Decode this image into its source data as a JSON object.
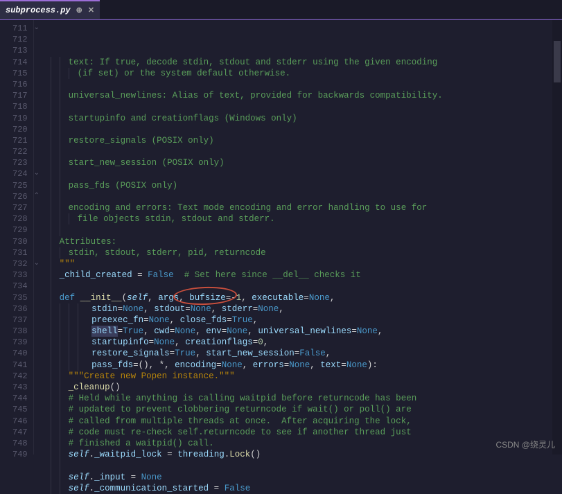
{
  "tab": {
    "filename": "subprocess.py"
  },
  "watermark": "CSDN @绕灵儿",
  "annotation": {
    "text": "shell=True",
    "style": "red-ellipse"
  },
  "lines": [
    {
      "n": 711,
      "fold": "v",
      "ind": 2,
      "seg": [
        [
          "c-comment",
          "text: If true, decode stdin, stdout and stderr using the given encoding"
        ]
      ]
    },
    {
      "n": 712,
      "ind": 3,
      "seg": [
        [
          "c-comment",
          "(if set) or the system default otherwise."
        ]
      ]
    },
    {
      "n": 713,
      "ind": 2,
      "seg": []
    },
    {
      "n": 714,
      "ind": 2,
      "seg": [
        [
          "c-comment",
          "universal_newlines: Alias of text, provided for backwards compatibility."
        ]
      ]
    },
    {
      "n": 715,
      "ind": 2,
      "seg": []
    },
    {
      "n": 716,
      "ind": 2,
      "seg": [
        [
          "c-comment",
          "startupinfo and creationflags (Windows only)"
        ]
      ]
    },
    {
      "n": 717,
      "ind": 2,
      "seg": []
    },
    {
      "n": 718,
      "ind": 2,
      "seg": [
        [
          "c-comment",
          "restore_signals (POSIX only)"
        ]
      ]
    },
    {
      "n": 719,
      "ind": 2,
      "seg": []
    },
    {
      "n": 720,
      "ind": 2,
      "seg": [
        [
          "c-comment",
          "start_new_session (POSIX only)"
        ]
      ]
    },
    {
      "n": 721,
      "ind": 2,
      "seg": []
    },
    {
      "n": 722,
      "ind": 2,
      "seg": [
        [
          "c-comment",
          "pass_fds (POSIX only)"
        ]
      ]
    },
    {
      "n": 723,
      "ind": 2,
      "seg": []
    },
    {
      "n": 724,
      "fold": "v",
      "ind": 2,
      "seg": [
        [
          "c-comment",
          "encoding and errors: Text mode encoding and error handling to use for"
        ]
      ]
    },
    {
      "n": 725,
      "ind": 3,
      "seg": [
        [
          "c-comment",
          "file objects stdin, stdout and stderr."
        ]
      ]
    },
    {
      "n": 726,
      "fold": "^",
      "ind": 2,
      "seg": []
    },
    {
      "n": 727,
      "ind": 1,
      "seg": [
        [
          "c-comment",
          "Attributes:"
        ]
      ]
    },
    {
      "n": 728,
      "ind": 2,
      "seg": [
        [
          "c-comment",
          "stdin, stdout, stderr, pid, returncode"
        ]
      ]
    },
    {
      "n": 729,
      "ind": 1,
      "seg": [
        [
          "c-string",
          "\"\"\""
        ]
      ]
    },
    {
      "n": 730,
      "ind": 1,
      "seg": [
        [
          "c-var",
          "_child_created"
        ],
        [
          "c-default",
          " = "
        ],
        [
          "c-bool",
          "False"
        ],
        [
          "c-default",
          "  "
        ],
        [
          "c-comment",
          "# Set here since __del__ checks it"
        ]
      ]
    },
    {
      "n": 731,
      "ind": 1,
      "seg": []
    },
    {
      "n": 732,
      "fold": "v",
      "ind": 1,
      "seg": [
        [
          "c-keyword",
          "def "
        ],
        [
          "c-func",
          "__init__"
        ],
        [
          "c-default",
          "("
        ],
        [
          "c-self",
          "self"
        ],
        [
          "c-default",
          ", "
        ],
        [
          "c-param",
          "args"
        ],
        [
          "c-default",
          ", "
        ],
        [
          "c-param",
          "bufsize"
        ],
        [
          "c-default",
          "=-"
        ],
        [
          "c-number",
          "1"
        ],
        [
          "c-default",
          ", "
        ],
        [
          "c-param",
          "executable"
        ],
        [
          "c-default",
          "="
        ],
        [
          "c-none",
          "None"
        ],
        [
          "c-default",
          ","
        ]
      ]
    },
    {
      "n": 733,
      "ind": 4,
      "seg": [
        [
          "c-default",
          " "
        ],
        [
          "c-param",
          "stdin"
        ],
        [
          "c-default",
          "="
        ],
        [
          "c-none",
          "None"
        ],
        [
          "c-default",
          ", "
        ],
        [
          "c-param",
          "stdout"
        ],
        [
          "c-default",
          "="
        ],
        [
          "c-none",
          "None"
        ],
        [
          "c-default",
          ", "
        ],
        [
          "c-param",
          "stderr"
        ],
        [
          "c-default",
          "="
        ],
        [
          "c-none",
          "None"
        ],
        [
          "c-default",
          ","
        ]
      ]
    },
    {
      "n": 734,
      "ind": 4,
      "seg": [
        [
          "c-default",
          " "
        ],
        [
          "c-param",
          "preexec_fn"
        ],
        [
          "c-default",
          "="
        ],
        [
          "c-none",
          "None"
        ],
        [
          "c-default",
          ", "
        ],
        [
          "c-param",
          "close_fds"
        ],
        [
          "c-default",
          "="
        ],
        [
          "c-bool",
          "True"
        ],
        [
          "c-default",
          ","
        ]
      ]
    },
    {
      "n": 735,
      "ind": 4,
      "seg": [
        [
          "c-default",
          " "
        ],
        [
          "sel",
          "shell"
        ],
        [
          "c-default",
          "="
        ],
        [
          "c-bool",
          "True"
        ],
        [
          "c-default",
          ", "
        ],
        [
          "c-param",
          "cwd"
        ],
        [
          "c-default",
          "="
        ],
        [
          "c-none",
          "None"
        ],
        [
          "c-default",
          ", "
        ],
        [
          "c-param",
          "env"
        ],
        [
          "c-default",
          "="
        ],
        [
          "c-none",
          "None"
        ],
        [
          "c-default",
          ", "
        ],
        [
          "c-param",
          "universal_newlines"
        ],
        [
          "c-default",
          "="
        ],
        [
          "c-none",
          "None"
        ],
        [
          "c-default",
          ","
        ]
      ]
    },
    {
      "n": 736,
      "ind": 4,
      "seg": [
        [
          "c-default",
          " "
        ],
        [
          "c-param",
          "startupinfo"
        ],
        [
          "c-default",
          "="
        ],
        [
          "c-none",
          "None"
        ],
        [
          "c-default",
          ", "
        ],
        [
          "c-param",
          "creationflags"
        ],
        [
          "c-default",
          "="
        ],
        [
          "c-number",
          "0"
        ],
        [
          "c-default",
          ","
        ]
      ]
    },
    {
      "n": 737,
      "ind": 4,
      "seg": [
        [
          "c-default",
          " "
        ],
        [
          "c-param",
          "restore_signals"
        ],
        [
          "c-default",
          "="
        ],
        [
          "c-bool",
          "True"
        ],
        [
          "c-default",
          ", "
        ],
        [
          "c-param",
          "start_new_session"
        ],
        [
          "c-default",
          "="
        ],
        [
          "c-bool",
          "False"
        ],
        [
          "c-default",
          ","
        ]
      ]
    },
    {
      "n": 738,
      "ind": 4,
      "seg": [
        [
          "c-default",
          " "
        ],
        [
          "c-param",
          "pass_fds"
        ],
        [
          "c-default",
          "=(), *, "
        ],
        [
          "c-param",
          "encoding"
        ],
        [
          "c-default",
          "="
        ],
        [
          "c-none",
          "None"
        ],
        [
          "c-default",
          ", "
        ],
        [
          "c-param",
          "errors"
        ],
        [
          "c-default",
          "="
        ],
        [
          "c-none",
          "None"
        ],
        [
          "c-default",
          ", "
        ],
        [
          "c-param",
          "text"
        ],
        [
          "c-default",
          "="
        ],
        [
          "c-none",
          "None"
        ],
        [
          "c-default",
          "):"
        ]
      ]
    },
    {
      "n": 739,
      "ind": 2,
      "seg": [
        [
          "c-string",
          "\"\"\"Create new Popen instance.\"\"\""
        ]
      ]
    },
    {
      "n": 740,
      "ind": 2,
      "seg": [
        [
          "c-func",
          "_cleanup"
        ],
        [
          "c-default",
          "()"
        ]
      ]
    },
    {
      "n": 741,
      "ind": 2,
      "seg": [
        [
          "c-comment",
          "# Held while anything is calling waitpid before returncode has been"
        ]
      ]
    },
    {
      "n": 742,
      "ind": 2,
      "seg": [
        [
          "c-comment",
          "# updated to prevent clobbering returncode if wait() or poll() are"
        ]
      ]
    },
    {
      "n": 743,
      "ind": 2,
      "seg": [
        [
          "c-comment",
          "# called from multiple threads at once.  After acquiring the lock,"
        ]
      ]
    },
    {
      "n": 744,
      "ind": 2,
      "seg": [
        [
          "c-comment",
          "# code must re-check self.returncode to see if another thread just"
        ]
      ]
    },
    {
      "n": 745,
      "ind": 2,
      "seg": [
        [
          "c-comment",
          "# finished a waitpid() call."
        ]
      ]
    },
    {
      "n": 746,
      "ind": 2,
      "seg": [
        [
          "c-self",
          "self"
        ],
        [
          "c-default",
          "."
        ],
        [
          "c-var",
          "_waitpid_lock"
        ],
        [
          "c-default",
          " = "
        ],
        [
          "c-var",
          "threading"
        ],
        [
          "c-default",
          "."
        ],
        [
          "c-func",
          "Lock"
        ],
        [
          "c-default",
          "()"
        ]
      ]
    },
    {
      "n": 747,
      "ind": 2,
      "seg": []
    },
    {
      "n": 748,
      "ind": 2,
      "seg": [
        [
          "c-self",
          "self"
        ],
        [
          "c-default",
          "."
        ],
        [
          "c-var",
          "_input"
        ],
        [
          "c-default",
          " = "
        ],
        [
          "c-none",
          "None"
        ]
      ]
    },
    {
      "n": 749,
      "ind": 2,
      "seg": [
        [
          "c-self",
          "self"
        ],
        [
          "c-default",
          "."
        ],
        [
          "c-var",
          "_communication_started"
        ],
        [
          "c-default",
          " = "
        ],
        [
          "c-bool",
          "False"
        ]
      ]
    }
  ]
}
